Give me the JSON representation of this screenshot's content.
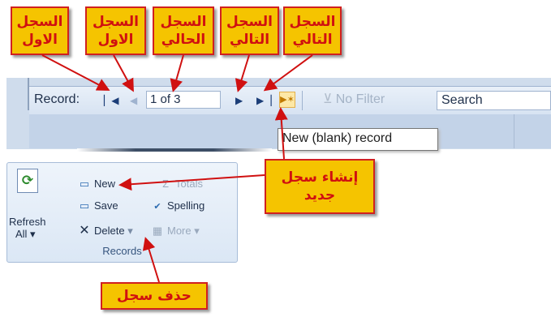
{
  "callouts": {
    "first_record": [
      "السجل",
      "الاول"
    ],
    "previous_record": [
      "السجل",
      "الاول"
    ],
    "current_record": [
      "السجل",
      "الحالي"
    ],
    "next_record": [
      "السجل",
      "التالي"
    ],
    "last_record": [
      "السجل",
      "التالي"
    ],
    "new_record": [
      "إنشاء سجل",
      "جديد"
    ],
    "delete_record": [
      "حذف سجل"
    ]
  },
  "record_bar": {
    "label": "Record:",
    "first_icon": "first-record-icon",
    "previous_icon": "previous-record-icon",
    "current_value": "1 of 3",
    "next_icon": "next-record-icon",
    "last_icon": "last-record-icon",
    "new_icon": "new-record-icon",
    "filter_label": "No Filter",
    "search_value": "Search"
  },
  "tooltip": "New (blank) record",
  "ribbon": {
    "refresh_label_1": "Refresh",
    "refresh_label_2": "All ▾",
    "new_label": "New",
    "save_label": "Save",
    "delete_label": "Delete",
    "totals_label": "Totals",
    "spelling_label": "Spelling",
    "more_label": "More",
    "group_name": "Records"
  },
  "colors": {
    "callout_fill": "#f5c400",
    "callout_text": "#d01010",
    "arrow": "#d01010"
  }
}
